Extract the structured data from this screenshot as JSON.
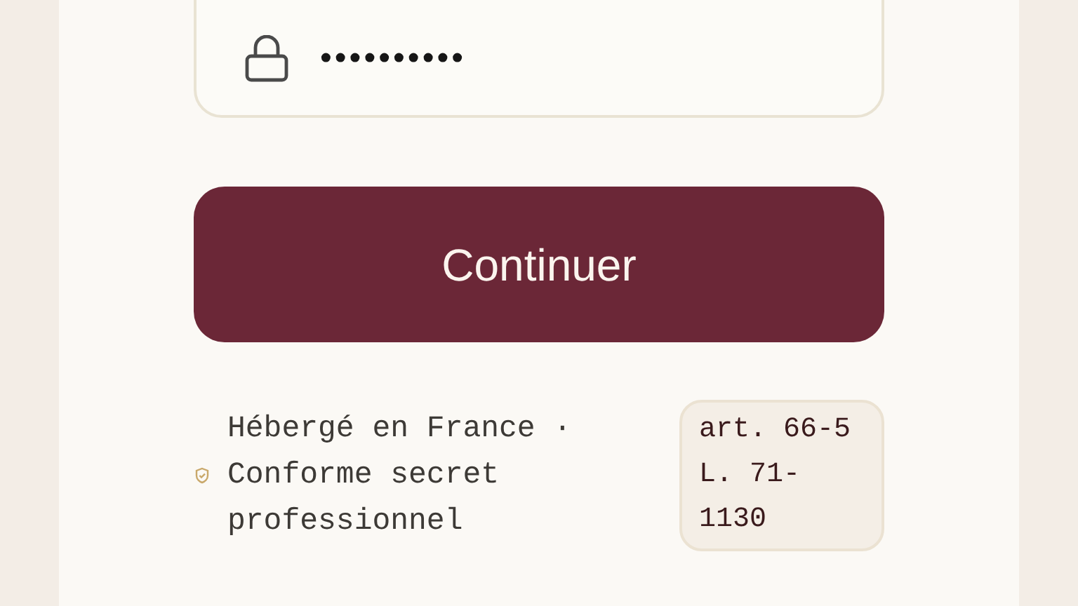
{
  "password_field": {
    "value": "••••••••••"
  },
  "submit_button": {
    "label": "Continuer"
  },
  "footer": {
    "notice": "Hébergé en France · Conforme secret professionnel",
    "legal_badge": "art. 66-5 L. 71-1130"
  }
}
